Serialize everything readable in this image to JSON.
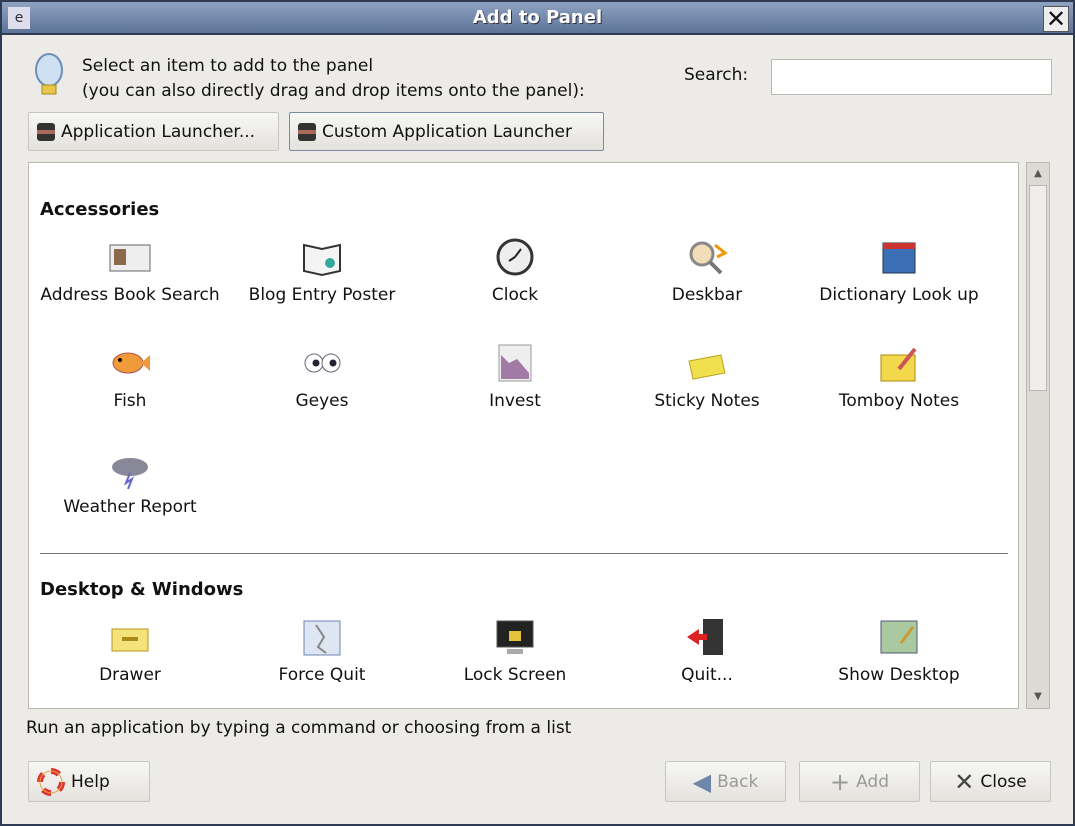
{
  "window": {
    "title": "Add to Panel",
    "close_glyph": "✕"
  },
  "header": {
    "line1": "Select an item to add to the panel",
    "line2": "(you can also directly drag and drop items onto the panel):",
    "search_label": "Search:",
    "search_value": "",
    "icon": "lightbulb-icon"
  },
  "launchers": [
    {
      "label": "Application Launcher..."
    },
    {
      "label": "Custom Application Launcher"
    }
  ],
  "sections": [
    {
      "title": "Accessories",
      "items": [
        {
          "label": "Address Book Search",
          "icon": "address-book-icon"
        },
        {
          "label": "Blog Entry Poster",
          "icon": "blog-icon"
        },
        {
          "label": "Clock",
          "icon": "clock-icon"
        },
        {
          "label": "Deskbar",
          "icon": "deskbar-icon"
        },
        {
          "label": "Dictionary Look up",
          "icon": "dictionary-icon"
        },
        {
          "label": "Fish",
          "icon": "fish-icon"
        },
        {
          "label": "Geyes",
          "icon": "eyes-icon"
        },
        {
          "label": "Invest",
          "icon": "invest-icon"
        },
        {
          "label": "Sticky Notes",
          "icon": "sticky-notes-icon"
        },
        {
          "label": "Tomboy Notes",
          "icon": "tomboy-icon"
        },
        {
          "label": "Weather Report",
          "icon": "weather-icon"
        }
      ]
    },
    {
      "title": "Desktop & Windows",
      "items": [
        {
          "label": "Drawer",
          "icon": "drawer-icon"
        },
        {
          "label": "Force Quit",
          "icon": "force-quit-icon"
        },
        {
          "label": "Lock Screen",
          "icon": "lock-screen-icon"
        },
        {
          "label": "Quit...",
          "icon": "quit-icon"
        },
        {
          "label": "Show Desktop",
          "icon": "show-desktop-icon"
        }
      ]
    }
  ],
  "status": "Run an application by typing a command or choosing from a list",
  "buttons": {
    "help": "Help",
    "back": "Back",
    "add": "Add",
    "close": "Close"
  },
  "colors": {
    "titlebar": "#6b82a8",
    "dialog_bg": "#ecebe7"
  }
}
